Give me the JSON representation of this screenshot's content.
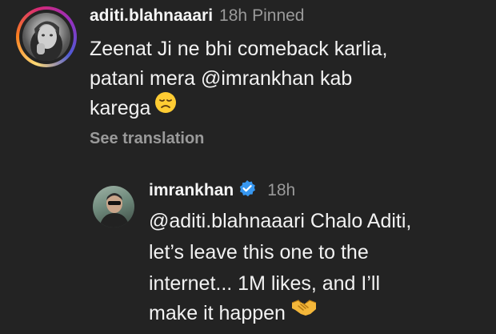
{
  "parent_comment": {
    "username": "aditi.blahnaaari",
    "time": "18h",
    "pinned_label": "Pinned",
    "text_lines": [
      "Zeenat Ji ne bhi comeback karlia,",
      "patani mera ",
      "@imrankhan",
      " kab",
      "karega"
    ],
    "emoji": "disappointed-face-emoji",
    "see_translation": "See translation"
  },
  "reply": {
    "username": "imrankhan",
    "verified_icon": "verified-badge-icon",
    "time": "18h",
    "text_lines": [
      "@aditi.blahnaaari",
      " Chalo Aditi,",
      "let’s leave this one to the",
      "internet... 1M likes, and I’ll",
      "make it happen"
    ],
    "emoji": "handshake-emoji"
  },
  "colors": {
    "background": "#232323",
    "text": "#f2f2f2",
    "muted": "#9a9a9a",
    "verified": "#3797f0"
  }
}
